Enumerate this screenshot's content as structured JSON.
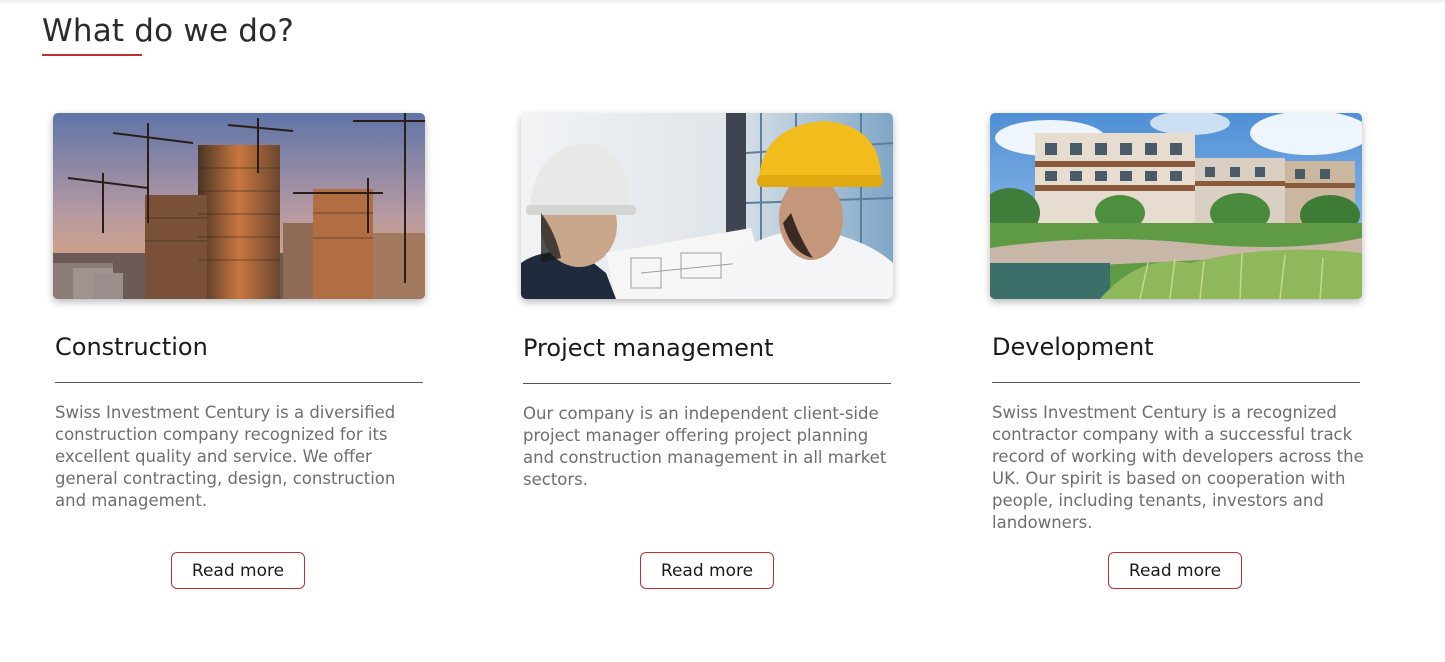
{
  "section": {
    "title": "What do we do?",
    "accent_color": "#c0302c"
  },
  "cards": [
    {
      "image_name": "construction-cranes-photo",
      "title": "Construction",
      "description": "Swiss Investment Century is a diversified construction company recognized for its excellent quality and service. We offer general contracting, design, construction and management.",
      "button_label": "Read more"
    },
    {
      "image_name": "engineers-hard-hats-photo",
      "title": "Project management",
      "description": "Our company is an independent client-side project manager offering project planning and construction management in all market sectors.",
      "button_label": "Read more"
    },
    {
      "image_name": "residential-development-photo",
      "title": "Development",
      "description": "Swiss Investment Century is a recognized contractor company with a successful track record of working with developers across the UK. Our spirit is based on cooperation with people, including tenants, investors and landowners.",
      "button_label": "Read more"
    }
  ]
}
